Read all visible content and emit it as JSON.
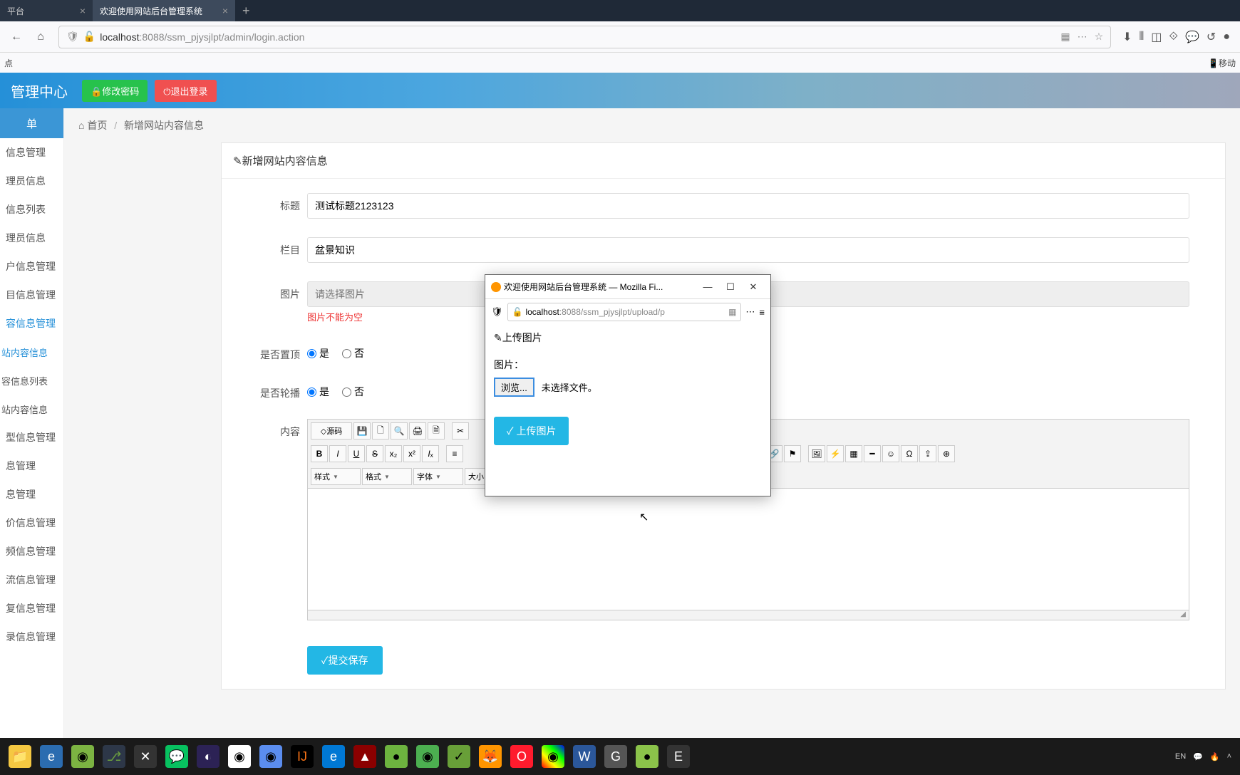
{
  "browser": {
    "tab1_label": "平台",
    "tab2_label": "欢迎使用网站后台管理系统",
    "url_host": "localhost",
    "url_port": ":8088",
    "url_path": "/ssm_pjysjlpt/admin/login.action",
    "bookmark_label": "点",
    "mobile_label": "移动"
  },
  "header": {
    "title": "管理中心",
    "change_pwd": "修改密码",
    "logout": "退出登录"
  },
  "sidebar": {
    "top": "单",
    "items": [
      "信息管理",
      "理员信息",
      "信息列表",
      "理员信息",
      "户信息管理",
      "目信息管理",
      "容信息管理",
      "站内容信息",
      "容信息列表",
      "站内容信息",
      "型信息管理",
      "息管理",
      "息管理",
      "价信息管理",
      "频信息管理",
      "流信息管理",
      "复信息管理",
      "录信息管理"
    ],
    "active_idx": 6,
    "sub_start": 7,
    "sub_end": 9
  },
  "breadcrumb": {
    "home": "首页",
    "current": "新增网站内容信息"
  },
  "panel": {
    "title": "新增网站内容信息"
  },
  "form": {
    "title_label": "标题",
    "title_value": "测试标题2123123",
    "cat_label": "栏目",
    "cat_value": "盆景知识",
    "img_label": "图片",
    "img_placeholder": "请选择图片",
    "img_error": "图片不能为空",
    "top_label": "是否置顶",
    "carousel_label": "是否轮播",
    "opt_yes": "是",
    "opt_no": "否",
    "content_label": "内容",
    "submit": "提交保存"
  },
  "editor": {
    "source": "源码",
    "styles": "样式",
    "format": "格式",
    "font": "字体",
    "size": "大小"
  },
  "popup": {
    "win_title": "欢迎使用网站后台管理系统 — Mozilla Fi...",
    "url_host": "localhost",
    "url_port": ":8088",
    "url_path": "/ssm_pjysjlpt/upload/p",
    "section": "上传图片",
    "file_label": "图片：",
    "browse": "浏览...",
    "no_file": "未选择文件。",
    "upload": "上传图片"
  },
  "taskbar": {
    "ime": "EN"
  },
  "colors": {
    "primary": "#23b7e5",
    "header": "#2590d8",
    "success": "#27c24c",
    "danger": "#f05050"
  }
}
